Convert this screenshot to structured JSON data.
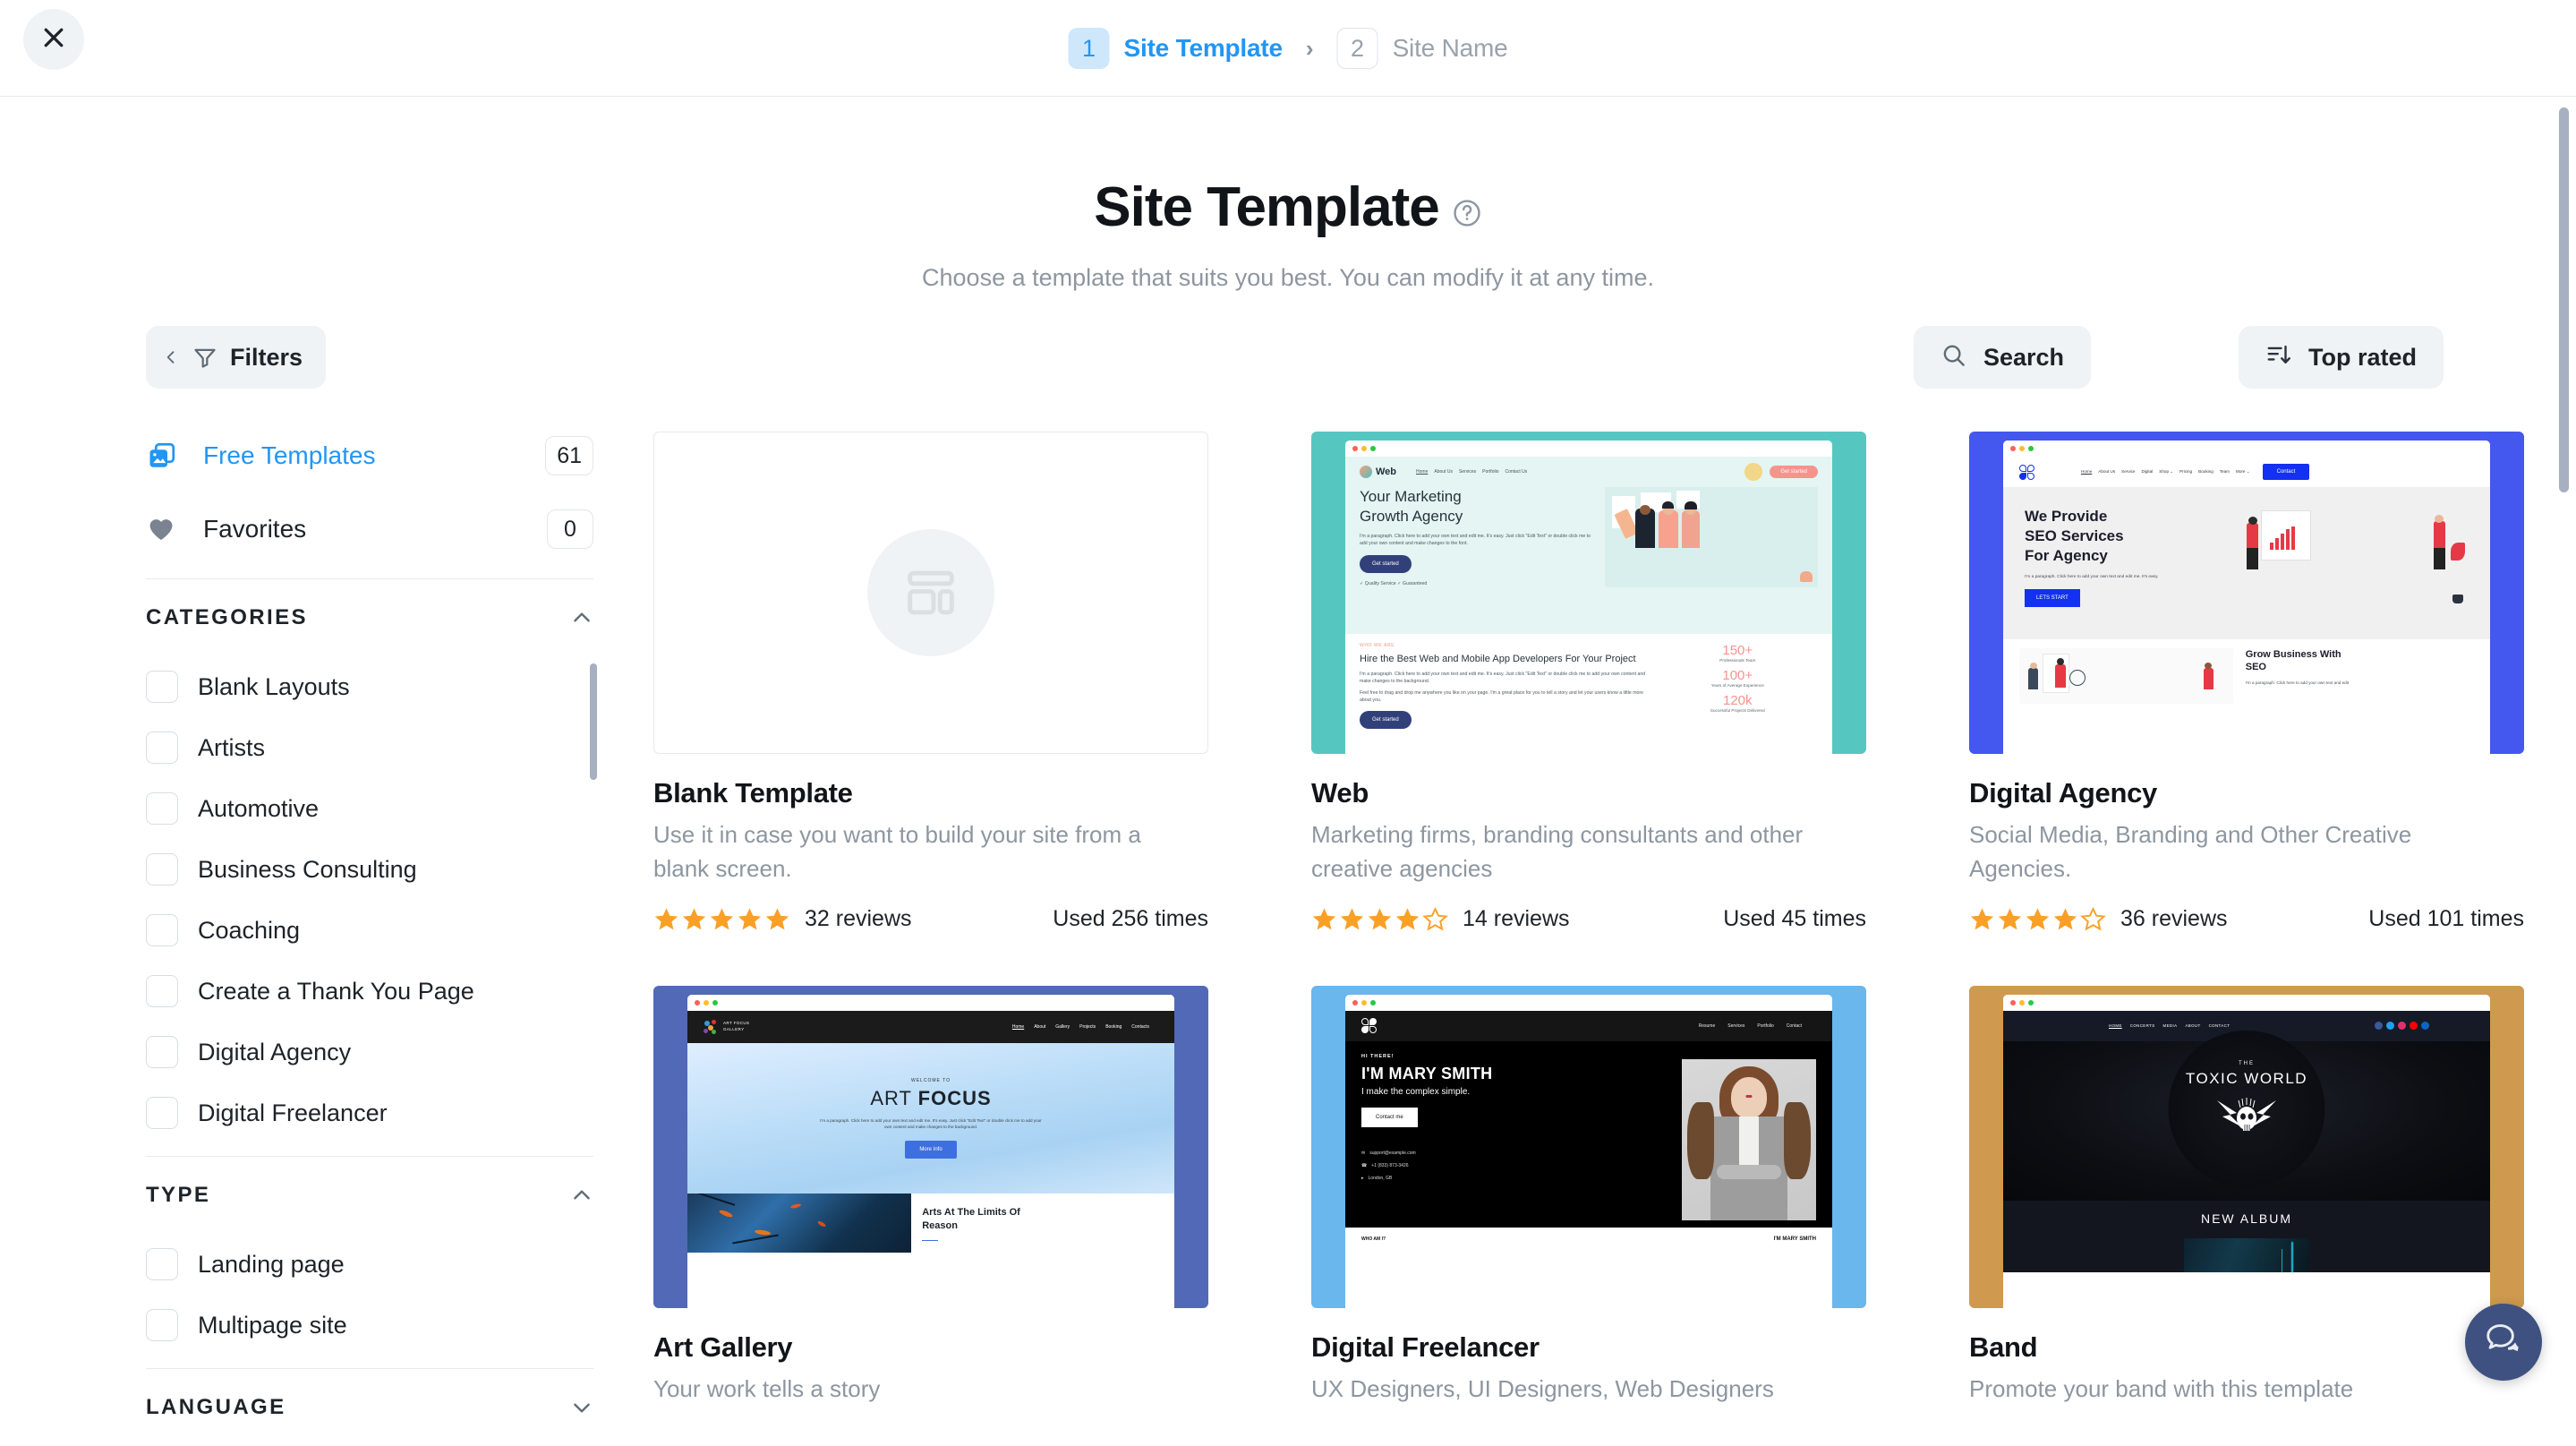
{
  "topbar": {
    "close_icon": "close-icon",
    "steps": [
      {
        "number": "1",
        "label": "Site Template",
        "state": "active"
      },
      {
        "number": "2",
        "label": "Site Name",
        "state": "inactive"
      }
    ],
    "separator": "›"
  },
  "page": {
    "title": "Site Template",
    "help_icon": "question-mark-circle-icon",
    "subtitle": "Choose a template that suits you best. You can modify it at any time."
  },
  "toolbar": {
    "filters_label": "Filters",
    "filters_back_icon": "chevron-left-icon",
    "filters_icon": "funnel-icon",
    "search_label": "Search",
    "search_icon": "search-icon",
    "sort_label": "Top rated",
    "sort_icon": "sort-descending-icon"
  },
  "sidebar": {
    "quick_items": [
      {
        "label": "Free Templates",
        "count": "61",
        "icon": "templates-icon",
        "active": true
      },
      {
        "label": "Favorites",
        "count": "0",
        "icon": "heart-icon",
        "active": false
      }
    ],
    "sections": [
      {
        "title": "CATEGORIES",
        "expanded": true,
        "chevron": "chevron-up-icon",
        "options": [
          "Blank Layouts",
          "Artists",
          "Automotive",
          "Business Consulting",
          "Coaching",
          "Create a Thank You Page",
          "Digital Agency",
          "Digital Freelancer"
        ]
      },
      {
        "title": "TYPE",
        "expanded": true,
        "chevron": "chevron-up-icon",
        "options": [
          "Landing page",
          "Multipage site"
        ]
      },
      {
        "title": "LANGUAGE",
        "expanded": false,
        "chevron": "chevron-down-icon",
        "options": []
      }
    ]
  },
  "templates": [
    {
      "id": "blank",
      "title": "Blank Template",
      "description": "Use it in case you want to build your site from a blank screen.",
      "stars_full": 5,
      "stars_empty": 0,
      "reviews": "32 reviews",
      "used": "Used 256 times",
      "preview_icon": "layout-placeholder-icon"
    },
    {
      "id": "web",
      "title": "Web",
      "description": "Marketing firms, branding consultants and other creative agencies",
      "stars_full": 4,
      "stars_empty": 1,
      "reviews": "14 reviews",
      "used": "Used 45 times",
      "preview": {
        "brand": "Web",
        "nav": [
          "Home",
          "About Us",
          "Services",
          "Portfolio",
          "Contact Us"
        ],
        "cta": "Get started",
        "headline": "Your Marketing\nGrowth Agency",
        "paragraph": "I'm a paragraph. Click here to add your own text and edit me. It's easy. Just click \"Edit Text\" or double click me to add your own content and make changes to the font.",
        "button": "Get started",
        "checks": "✓ Quality Service   ✓ Guaranteed",
        "eyebrow": "WHO WE ARE",
        "subhead": "Hire the Best Web and Mobile App Developers For Your Project",
        "body1": "I'm a paragraph. Click here to add your own text and edit me. It's easy. Just click \"Edit Text\" or double click me to add your own content and make changes to the background.",
        "body2": "Feel free to drag and drop me anywhere you like on your page. I'm a great place for you to tell a story and let your users know a little more about you.",
        "button2": "Get started",
        "stats": [
          {
            "value": "150+",
            "label": "Professionals Team"
          },
          {
            "value": "100+",
            "label": "Years of Average Experience"
          },
          {
            "value": "120k",
            "label": "Successful Projects Delivered"
          }
        ]
      }
    },
    {
      "id": "digital-agency",
      "title": "Digital Agency",
      "description": "Social Media, Branding and Other Creative Agencies.",
      "stars_full": 4,
      "stars_empty": 1,
      "reviews": "36 reviews",
      "used": "Used 101 times",
      "preview": {
        "nav": [
          "Home",
          "About Us",
          "Service",
          "Digital",
          "Shop ⌄",
          "Pricing",
          "Booking",
          "Team",
          "More ⌄"
        ],
        "cta": "Contact",
        "headline": "We Provide\nSEO Services\nFor Agency",
        "paragraph": "I'm a paragraph. Click here to add your own text and edit me. It's easy.",
        "button": "LETS START",
        "subhead": "Grow Business With SEO",
        "body": "I'm a paragraph. Click here to add your own text and edit"
      }
    },
    {
      "id": "art-gallery",
      "title": "Art Gallery",
      "description": "Your work tells a story",
      "preview": {
        "brand": "ART FOCUS",
        "brand_sub": "GALLERY",
        "nav": [
          "Home",
          "About",
          "Gallery",
          "Projects",
          "Booking",
          "Contacts"
        ],
        "welcome": "WELCOME TO",
        "title_light": "ART ",
        "title_bold": "FOCUS",
        "paragraph": "I'm a paragraph. Click here to add your own text and edit me. It's easy. Just click \"Edit Text\" or double click me to add your own content and make changes to the background.",
        "button": "More Info",
        "subhead": "Arts At The Limits Of Reason"
      }
    },
    {
      "id": "digital-freelancer",
      "title": "Digital Freelancer",
      "description": "UX Designers, UI Designers, Web Designers",
      "preview": {
        "nav": [
          "Resume",
          "Services",
          "Portfolio",
          "Contact"
        ],
        "hi": "HI THERE!",
        "headline": "I'M MARY SMITH",
        "subhead": "I make the complex simple.",
        "button": "Contact me",
        "email": "support@example.com",
        "phone": "+1 (833) 873-3426",
        "location": "London, GB",
        "footer": "WHO AM I?"
      }
    },
    {
      "id": "band",
      "title": "Band",
      "description": "Promote your band with this template",
      "preview": {
        "nav": [
          "HOME",
          "CONCERTS",
          "MEDIA",
          "ABOUT",
          "CONTACT"
        ],
        "the": "THE",
        "title": "TOXIC WORLD",
        "album": "NEW ALBUM"
      }
    }
  ],
  "chat": {
    "icon": "chat-bubble-icon"
  },
  "colors": {
    "accent": "#2196f3",
    "star": "#fba026",
    "chip_bg": "#eff3f6",
    "text": "#1d2328",
    "muted": "#8d96a0",
    "chat_bg": "#3e5180"
  }
}
